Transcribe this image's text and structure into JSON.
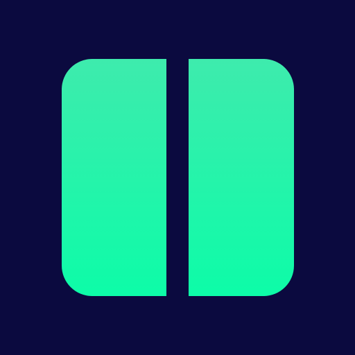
{
  "icon": {
    "name": "split-panel-icon",
    "colors": {
      "background": "#0b0a3f",
      "panel_top": "#3eebad",
      "panel_bottom": "#0dfca8"
    }
  }
}
